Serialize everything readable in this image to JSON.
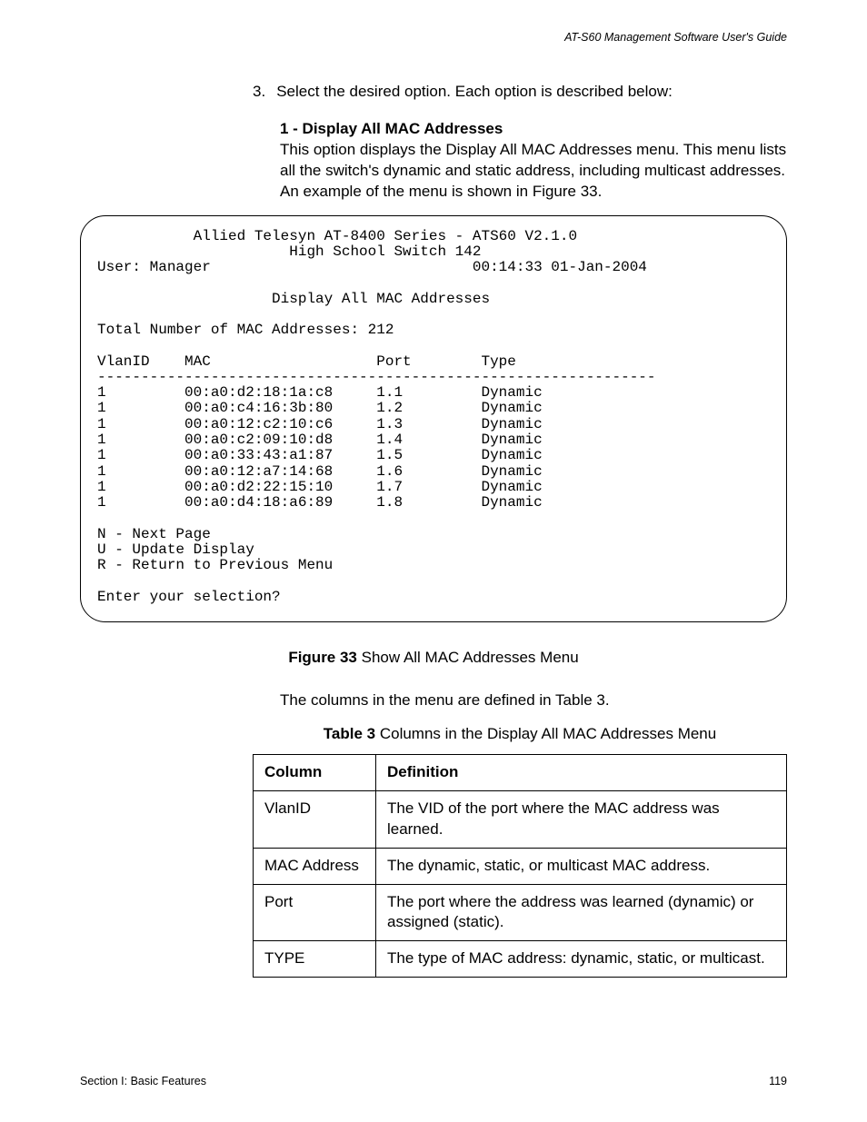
{
  "run_head": "AT-S60 Management Software User's Guide",
  "step": {
    "num": "3.",
    "text": "Select the desired option. Each option is described below:"
  },
  "option": {
    "title": "1 - Display All MAC Addresses",
    "body": "This option displays the Display All MAC Addresses menu. This menu lists all the switch's dynamic and static address, including multicast addresses. An example of the menu is shown in Figure 33."
  },
  "terminal": {
    "title1": "Allied Telesyn AT-8400 Series - ATS60 V2.1.0",
    "title2": "High School Switch 142",
    "user_label": "User: Manager",
    "datetime": "00:14:33 01-Jan-2004",
    "screen_title": "Display All MAC Addresses",
    "total_line": "Total Number of MAC Addresses: 212",
    "col_vlan": "VlanID",
    "col_mac": "MAC",
    "col_port": "Port",
    "col_type": "Type",
    "divider": "----------------------------------------------------------------",
    "rows": [
      {
        "vlan": "1",
        "mac": "00:a0:d2:18:1a:c8",
        "port": "1.1",
        "type": "Dynamic"
      },
      {
        "vlan": "1",
        "mac": "00:a0:c4:16:3b:80",
        "port": "1.2",
        "type": "Dynamic"
      },
      {
        "vlan": "1",
        "mac": "00:a0:12:c2:10:c6",
        "port": "1.3",
        "type": "Dynamic"
      },
      {
        "vlan": "1",
        "mac": "00:a0:c2:09:10:d8",
        "port": "1.4",
        "type": "Dynamic"
      },
      {
        "vlan": "1",
        "mac": "00:a0:33:43:a1:87",
        "port": "1.5",
        "type": "Dynamic"
      },
      {
        "vlan": "1",
        "mac": "00:a0:12:a7:14:68",
        "port": "1.6",
        "type": "Dynamic"
      },
      {
        "vlan": "1",
        "mac": "00:a0:d2:22:15:10",
        "port": "1.7",
        "type": "Dynamic"
      },
      {
        "vlan": "1",
        "mac": "00:a0:d4:18:a6:89",
        "port": "1.8",
        "type": "Dynamic"
      }
    ],
    "menu_n": "N - Next Page",
    "menu_u": "U - Update Display",
    "menu_r": "R - Return to Previous Menu",
    "prompt": "Enter your selection?"
  },
  "figcap": {
    "lead": "Figure 33",
    "rest": "  Show All MAC Addresses Menu"
  },
  "after_fig": "The columns in the menu are defined in Table 3.",
  "tabcap": {
    "lead": "Table 3",
    "rest": "  Columns in the Display All MAC Addresses Menu"
  },
  "table": {
    "head_a": "Column",
    "head_b": "Definition",
    "rows": [
      {
        "a": "VlanID",
        "b": "The VID of the port where the MAC address was learned."
      },
      {
        "a": "MAC Address",
        "b": "The dynamic, static, or multicast MAC address."
      },
      {
        "a": "Port",
        "b": "The port where the address was learned (dynamic) or assigned (static)."
      },
      {
        "a": "TYPE",
        "b": "The type of MAC address: dynamic, static, or multicast."
      }
    ]
  },
  "footer": {
    "left": "Section I: Basic Features",
    "right": "119"
  }
}
